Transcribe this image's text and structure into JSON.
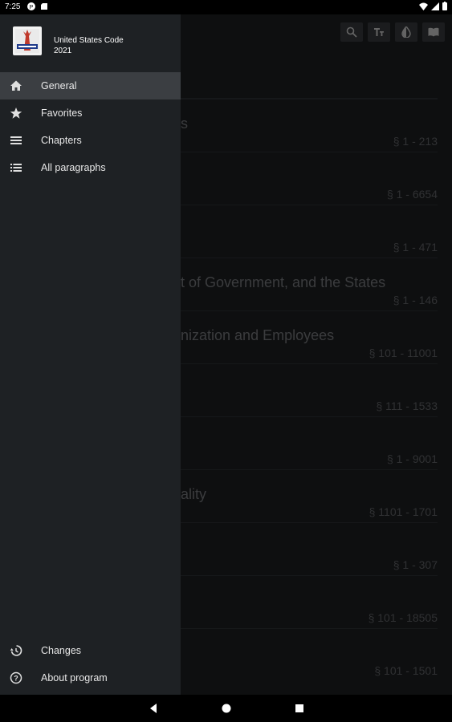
{
  "status_bar": {
    "time": "7:25"
  },
  "app": {
    "name_line1": "United States Code",
    "name_line2": "2021"
  },
  "toolbar": {
    "icons": [
      "search-icon",
      "text-size-icon",
      "contrast-icon",
      "book-icon"
    ]
  },
  "drawer": {
    "items": [
      {
        "label": "General",
        "icon": "home-icon",
        "active": true
      },
      {
        "label": "Favorites",
        "icon": "star-icon",
        "active": false
      },
      {
        "label": "Chapters",
        "icon": "menu-icon",
        "active": false
      },
      {
        "label": "All paragraphs",
        "icon": "list-icon",
        "active": false
      }
    ],
    "footer": [
      {
        "label": "Changes",
        "icon": "history-icon"
      },
      {
        "label": "About program",
        "icon": "help-icon"
      }
    ]
  },
  "list": {
    "rows": [
      {
        "title": "s",
        "range": "§ 1 - 213"
      },
      {
        "title": "",
        "range": "§ 1 - 6654"
      },
      {
        "title": "",
        "range": "§ 1 - 471"
      },
      {
        "title": "t of Government, and the States",
        "range": "§ 1 - 146"
      },
      {
        "title": "nization and Employees",
        "range": "§ 101 - 11001"
      },
      {
        "title": "",
        "range": "§ 111 - 1533"
      },
      {
        "title": "",
        "range": "§ 1 - 9001"
      },
      {
        "title": "ality",
        "range": "§ 1101 - 1701"
      },
      {
        "title": "",
        "range": "§ 1 - 307"
      },
      {
        "title": "",
        "range": "§ 101 - 18505"
      },
      {
        "title": "",
        "range": "§ 101 - 1501"
      }
    ]
  },
  "colors": {
    "drawer_bg": "#1e2124",
    "active_item_bg": "#3b3e42",
    "app_bg": "#161719"
  }
}
